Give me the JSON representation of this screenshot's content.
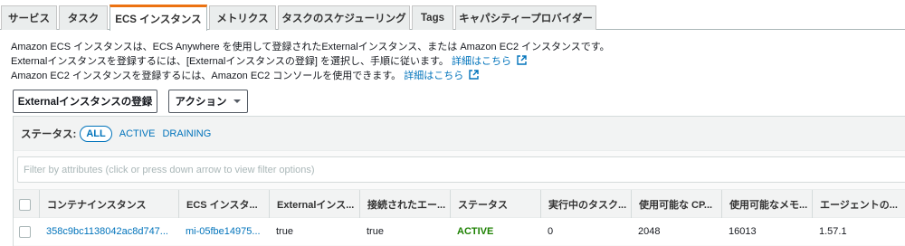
{
  "tabs": [
    {
      "label": "サービス"
    },
    {
      "label": "タスク"
    },
    {
      "label": "ECS インスタンス",
      "active": true
    },
    {
      "label": "メトリクス"
    },
    {
      "label": "タスクのスケジューリング"
    },
    {
      "label": "Tags"
    },
    {
      "label": "キャパシティープロバイダー"
    }
  ],
  "description": {
    "line1": "Amazon ECS インスタンスは、ECS Anywhere を使用して登録されたExternalインスタンス、または Amazon EC2 インスタンスです。",
    "line2_text": "Externalインスタンスを登録するには、[Externalインスタンスの登録] を選択し、手順に従います。",
    "line2_link": "詳細はこちら",
    "line3_text": "Amazon EC2 インスタンスを登録するには、Amazon EC2 コンソールを使用できます。",
    "line3_link": "詳細はこちら"
  },
  "buttons": {
    "register_external": "Externalインスタンスの登録",
    "actions": "アクション"
  },
  "status_filter": {
    "label": "ステータス:",
    "options": [
      "ALL",
      "ACTIVE",
      "DRAINING"
    ],
    "selected": "ALL"
  },
  "filter": {
    "placeholder": "Filter by attributes (click or press down arrow to view filter options)"
  },
  "table": {
    "columns": [
      "コンテナインスタンス",
      "ECS インスタ...",
      "Externalインス...",
      "接続されたエー...",
      "ステータス",
      "実行中のタスク...",
      "使用可能な CP...",
      "使用可能なメモ...",
      "エージェントの..."
    ],
    "rows": [
      [
        "358c9bc1138042ac8d747...",
        "mi-05fbe14975...",
        "true",
        "true",
        "ACTIVE",
        "0",
        "2048",
        "16013",
        "1.57.1"
      ]
    ]
  },
  "colors": {
    "accent": "#ec7211",
    "link": "#0073bb",
    "active_status": "#1d8102"
  }
}
